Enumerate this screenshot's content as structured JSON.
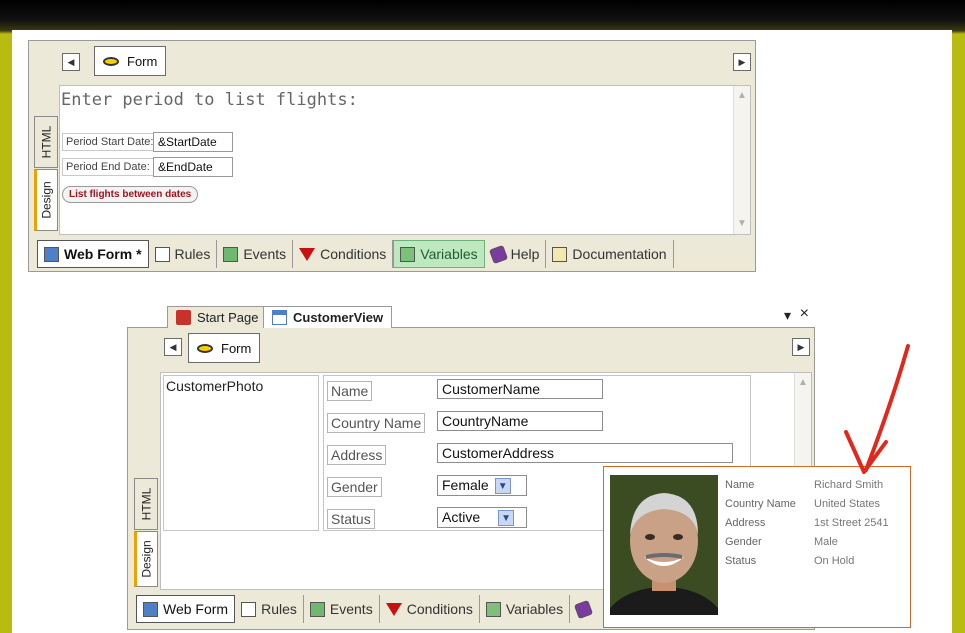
{
  "top_editor": {
    "form_label": "Form",
    "heading": "Enter period to list flights:",
    "fields": [
      {
        "label": "Period Start Date:",
        "value": "&StartDate"
      },
      {
        "label": "Period End Date:",
        "value": "&EndDate"
      }
    ],
    "button_label": "List flights between dates",
    "side_tabs": [
      "HTML",
      "Design"
    ],
    "bottom_tabs": [
      "Web Form *",
      "Rules",
      "Events",
      "Conditions",
      "Variables",
      "Help",
      "Documentation"
    ]
  },
  "bottom_editor": {
    "doc_tabs": [
      "Start Page",
      "CustomerView"
    ],
    "window_controls": {
      "dropdown": "▾",
      "close": "×"
    },
    "form_label": "Form",
    "photo_placeholder": "CustomerPhoto",
    "fields": [
      {
        "label": "Name",
        "value": "CustomerName"
      },
      {
        "label": "Country Name",
        "value": "CountryName"
      },
      {
        "label": "Address",
        "value": "CustomerAddress"
      },
      {
        "label": "Gender",
        "value": "Female"
      },
      {
        "label": "Status",
        "value": "Active"
      }
    ],
    "side_tabs": [
      "HTML",
      "Design"
    ],
    "bottom_tabs": [
      "Web Form",
      "Rules",
      "Events",
      "Conditions",
      "Variables"
    ]
  },
  "preview_card": {
    "rows": [
      {
        "label": "Name",
        "value": "Richard Smith"
      },
      {
        "label": "Country Name",
        "value": "United States"
      },
      {
        "label": "Address",
        "value": "1st Street 2541"
      },
      {
        "label": "Gender",
        "value": "Male"
      },
      {
        "label": "Status",
        "value": "On Hold"
      }
    ]
  },
  "colors": {
    "frame": "#b8bb10",
    "arrow": "#e0281c",
    "card_border": "#d06a2a"
  }
}
